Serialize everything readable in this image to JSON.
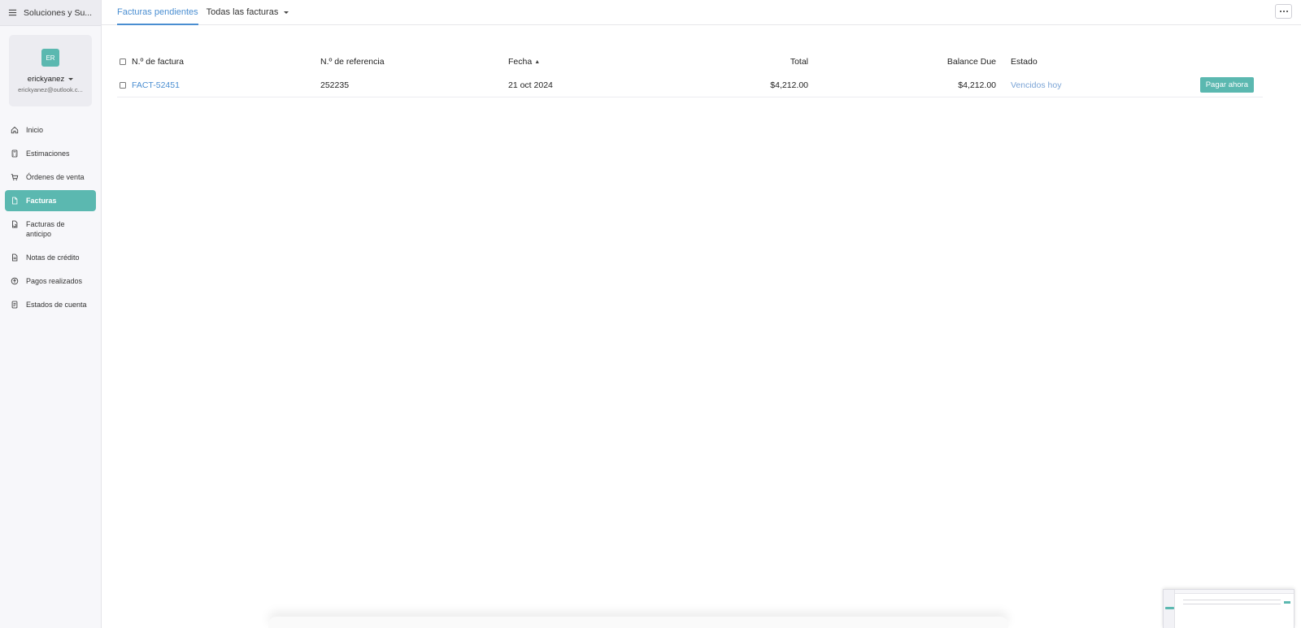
{
  "sidebar": {
    "org_name": "Soluciones y Su...",
    "profile": {
      "initials": "ER",
      "username": "erickyanez",
      "email": "erickyanez@outlook.c..."
    },
    "nav": [
      {
        "label": "Inicio",
        "icon": "home-icon",
        "active": false
      },
      {
        "label": "Estimaciones",
        "icon": "calculator-icon",
        "active": false
      },
      {
        "label": "Órdenes de venta",
        "icon": "cart-icon",
        "active": false
      },
      {
        "label": "Facturas",
        "icon": "document-icon",
        "active": true
      },
      {
        "label": "Facturas de anticipo",
        "icon": "document-refresh-icon",
        "active": false
      },
      {
        "label": "Notas de crédito",
        "icon": "credit-note-icon",
        "active": false
      },
      {
        "label": "Pagos realizados",
        "icon": "payment-upload-icon",
        "active": false
      },
      {
        "label": "Estados de cuenta",
        "icon": "statement-icon",
        "active": false
      }
    ]
  },
  "tabs": {
    "pending": "Facturas pendientes",
    "all": "Todas las facturas"
  },
  "table": {
    "headers": {
      "invoice_no": "N.º de factura",
      "reference_no": "N.º de referencia",
      "date": "Fecha",
      "total": "Total",
      "balance_due": "Balance Due",
      "status": "Estado"
    },
    "rows": [
      {
        "invoice_no": "FACT-52451",
        "reference_no": "252235",
        "date": "21 oct 2024",
        "total": "$4,212.00",
        "balance_due": "$4,212.00",
        "status": "Vencidos hoy",
        "action": "Pagar ahora"
      }
    ]
  },
  "colors": {
    "accent": "#5bb8b0",
    "link": "#4a8ed1"
  }
}
